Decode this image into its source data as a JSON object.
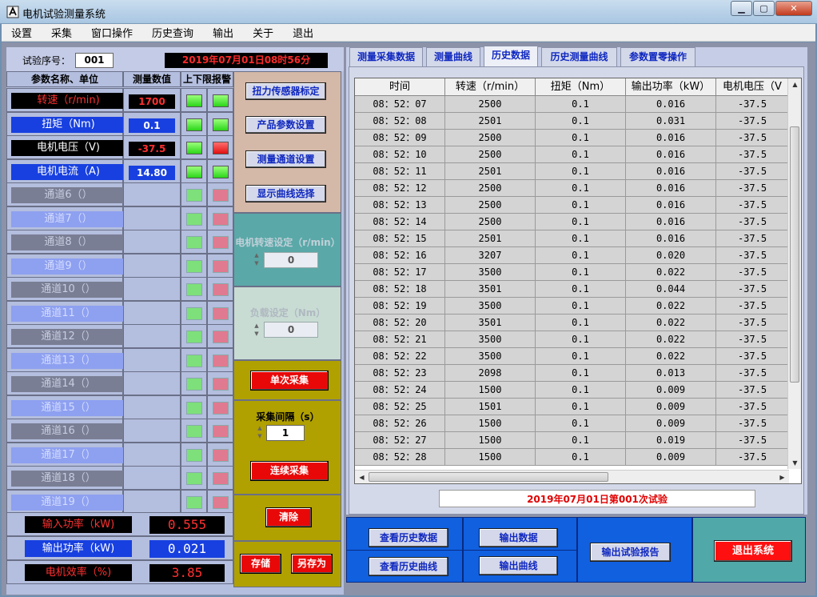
{
  "window": {
    "title": "电机试验测量系统"
  },
  "menu": [
    "设置",
    "采集",
    "窗口操作",
    "历史查询",
    "输出",
    "关于",
    "退出"
  ],
  "trial": {
    "label": "试验序号：",
    "number": "001",
    "datetime": "2019年07月01日08时56分"
  },
  "grid_headers": {
    "param": "参数名称、单位",
    "value": "测量数值",
    "alarm": "上下限报警"
  },
  "channels": [
    {
      "name": "转速（r/min)",
      "value": "1700",
      "style": "black",
      "lo": "g",
      "hi": "g"
    },
    {
      "name": "扭矩（Nm)",
      "value": "0.1",
      "style": "blue",
      "lo": "g",
      "hi": "g"
    },
    {
      "name": "电机电压（V)",
      "value": "-37.5",
      "style": "blackw",
      "lo": "g",
      "hi": "r"
    },
    {
      "name": "电机电流（A)",
      "value": "14.80",
      "style": "blue",
      "lo": "g",
      "hi": "g"
    },
    {
      "name": "通道6（）",
      "value": "",
      "style": "dis-d",
      "lo": "gd",
      "hi": "rd"
    },
    {
      "name": "通道7（）",
      "value": "",
      "style": "dis-l",
      "lo": "gd",
      "hi": "rd"
    },
    {
      "name": "通道8（）",
      "value": "",
      "style": "dis-d",
      "lo": "gd",
      "hi": "rd"
    },
    {
      "name": "通道9（）",
      "value": "",
      "style": "dis-l",
      "lo": "gd",
      "hi": "rd"
    },
    {
      "name": "通道10（）",
      "value": "",
      "style": "dis-d",
      "lo": "gd",
      "hi": "rd"
    },
    {
      "name": "通道11（）",
      "value": "",
      "style": "dis-l",
      "lo": "gd",
      "hi": "rd"
    },
    {
      "name": "通道12（）",
      "value": "",
      "style": "dis-d",
      "lo": "gd",
      "hi": "rd"
    },
    {
      "name": "通道13（）",
      "value": "",
      "style": "dis-l",
      "lo": "gd",
      "hi": "rd"
    },
    {
      "name": "通道14（）",
      "value": "",
      "style": "dis-d",
      "lo": "gd",
      "hi": "rd"
    },
    {
      "name": "通道15（）",
      "value": "",
      "style": "dis-l",
      "lo": "gd",
      "hi": "rd"
    },
    {
      "name": "通道16（）",
      "value": "",
      "style": "dis-d",
      "lo": "gd",
      "hi": "rd"
    },
    {
      "name": "通道17（）",
      "value": "",
      "style": "dis-l",
      "lo": "gd",
      "hi": "rd"
    },
    {
      "name": "通道18（）",
      "value": "",
      "style": "dis-d",
      "lo": "gd",
      "hi": "rd"
    },
    {
      "name": "通道19（）",
      "value": "",
      "style": "dis-l",
      "lo": "gd",
      "hi": "rd"
    }
  ],
  "power": [
    {
      "name": "输入功率（kW)",
      "value": "0.555",
      "style": "black"
    },
    {
      "name": "输出功率（kW)",
      "value": "0.021",
      "style": "blue"
    },
    {
      "name": "电机效率（%)",
      "value": "3.85",
      "style": "black"
    }
  ],
  "mid": {
    "sensor_calib": "扭力传感器标定",
    "product_params": "产品参数设置",
    "channel_setup": "测量通道设置",
    "curve_select": "显示曲线选择",
    "speed_set_label": "电机转速设定（r/min）",
    "speed_set_value": "0",
    "load_set_label": "负载设定（Nm）",
    "load_set_value": "0",
    "single_acquire": "单次采集",
    "interval_label": "采集间隔（s）",
    "interval_value": "1",
    "continuous_acquire": "连续采集",
    "clear": "清除",
    "save": "存储",
    "save_as": "另存为"
  },
  "tabs": [
    "测量采集数据",
    "测量曲线",
    "历史数据",
    "历史测量曲线",
    "参数置零操作"
  ],
  "active_tab": 2,
  "table": {
    "columns": [
      "时间",
      "转速（r/min）",
      "扭矩（Nm）",
      "输出功率（kW）",
      "电机电压（V"
    ],
    "rows": [
      [
        "08：52：07",
        "2500",
        "0.1",
        "0.016",
        "-37.5"
      ],
      [
        "08：52：08",
        "2501",
        "0.1",
        "0.031",
        "-37.5"
      ],
      [
        "08：52：09",
        "2500",
        "0.1",
        "0.016",
        "-37.5"
      ],
      [
        "08：52：10",
        "2500",
        "0.1",
        "0.016",
        "-37.5"
      ],
      [
        "08：52：11",
        "2501",
        "0.1",
        "0.016",
        "-37.5"
      ],
      [
        "08：52：12",
        "2500",
        "0.1",
        "0.016",
        "-37.5"
      ],
      [
        "08：52：13",
        "2500",
        "0.1",
        "0.016",
        "-37.5"
      ],
      [
        "08：52：14",
        "2500",
        "0.1",
        "0.016",
        "-37.5"
      ],
      [
        "08：52：15",
        "2501",
        "0.1",
        "0.016",
        "-37.5"
      ],
      [
        "08：52：16",
        "3207",
        "0.1",
        "0.020",
        "-37.5"
      ],
      [
        "08：52：17",
        "3500",
        "0.1",
        "0.022",
        "-37.5"
      ],
      [
        "08：52：18",
        "3501",
        "0.1",
        "0.044",
        "-37.5"
      ],
      [
        "08：52：19",
        "3500",
        "0.1",
        "0.022",
        "-37.5"
      ],
      [
        "08：52：20",
        "3501",
        "0.1",
        "0.022",
        "-37.5"
      ],
      [
        "08：52：21",
        "3500",
        "0.1",
        "0.022",
        "-37.5"
      ],
      [
        "08：52：22",
        "3500",
        "0.1",
        "0.022",
        "-37.5"
      ],
      [
        "08：52：23",
        "2098",
        "0.1",
        "0.013",
        "-37.5"
      ],
      [
        "08：52：24",
        "1500",
        "0.1",
        "0.009",
        "-37.5"
      ],
      [
        "08：52：25",
        "1501",
        "0.1",
        "0.009",
        "-37.5"
      ],
      [
        "08：52：26",
        "1500",
        "0.1",
        "0.009",
        "-37.5"
      ],
      [
        "08：52：27",
        "1500",
        "0.1",
        "0.019",
        "-37.5"
      ],
      [
        "08：52：28",
        "1500",
        "0.1",
        "0.009",
        "-37.5"
      ]
    ]
  },
  "status_text": "2019年07月01日第001次试验",
  "actions": {
    "view_history_data": "查看历史数据",
    "view_history_curve": "查看历史曲线",
    "export_data": "输出数据",
    "export_curve": "输出曲线",
    "export_report": "输出试验报告",
    "exit_system": "退出系统"
  },
  "colors": {
    "mid_beige": "#d4b8a8",
    "mid_teal": "#5aa8a8",
    "mid_pale": "#c8dcd4",
    "mid_olive": "#b0a000",
    "action_blue": "#1060e0",
    "exit_teal": "#50a8a8"
  }
}
